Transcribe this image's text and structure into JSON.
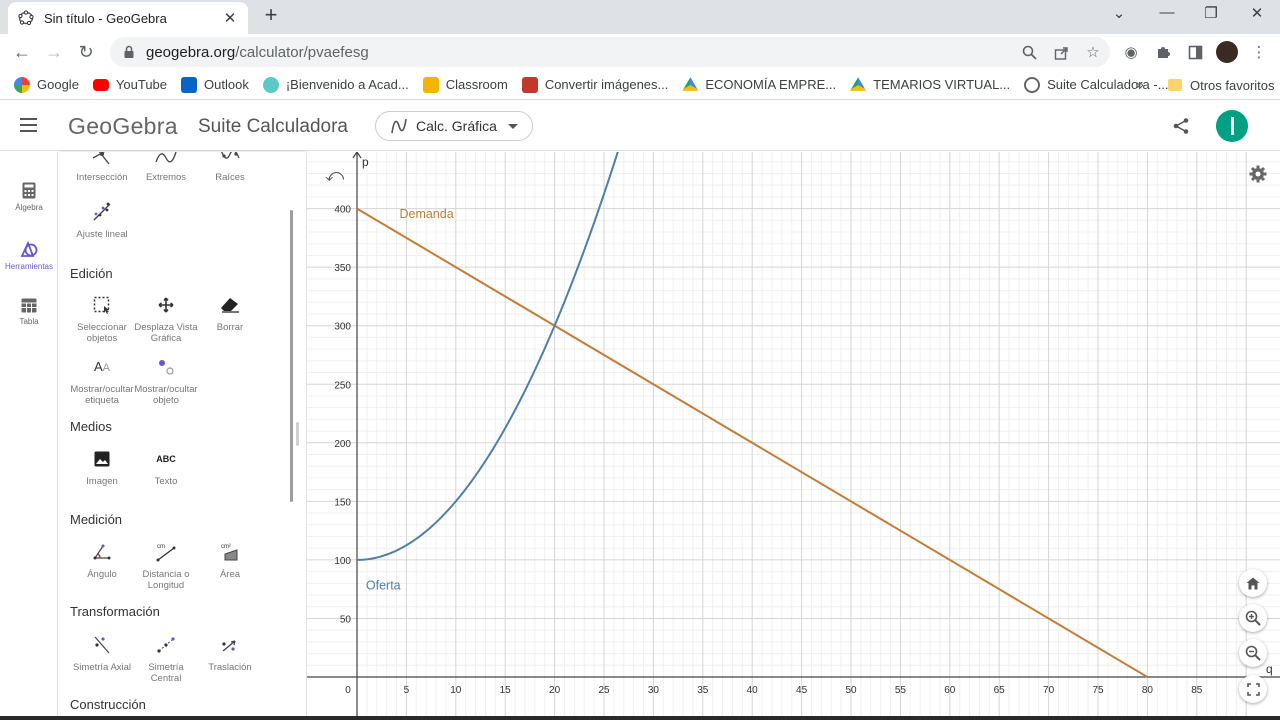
{
  "browser": {
    "tab_title": "Sin título - GeoGebra",
    "url_host": "geogebra.org",
    "url_path": "/calculator/pvaefesg",
    "bookmarks": [
      {
        "label": "Google",
        "color": "#4285f4"
      },
      {
        "label": "YouTube",
        "color": "#ff0000"
      },
      {
        "label": "Outlook",
        "color": "#0a64c8"
      },
      {
        "label": "¡Bienvenido a Acad...",
        "color": "#5cc8c8"
      },
      {
        "label": "Classroom",
        "color": "#f4b400"
      },
      {
        "label": "Convertir imágenes...",
        "color": "#c0392b"
      },
      {
        "label": "ECONOMÍA EMPRE...",
        "color": "#1fa463"
      },
      {
        "label": "TEMARIOS VIRTUAL...",
        "color": "#1fa463"
      },
      {
        "label": "Suite Calculadora -...",
        "color": "#666666"
      }
    ],
    "other_bookmarks": "Otros favoritos"
  },
  "app": {
    "logo": "GeoGebra",
    "suite_title": "Suite Calculadora",
    "app_selector": "Calc. Gráfica",
    "rail": [
      {
        "label": "Álgebra"
      },
      {
        "label": "Herramientas"
      },
      {
        "label": "Tabla"
      }
    ]
  },
  "tools": {
    "top_row": [
      "Intersección",
      "Extremos",
      "Raíces"
    ],
    "ajuste": "Ajuste lineal",
    "sections": {
      "edicion": "Edición",
      "medios": "Medios",
      "medicion": "Medición",
      "transformacion": "Transformación",
      "construccion": "Construcción"
    },
    "edicion": [
      {
        "line1": "Seleccionar",
        "line2": "objetos"
      },
      {
        "line1": "Desplaza Vista",
        "line2": "Gráfica"
      },
      {
        "line1": "Borrar",
        "line2": ""
      },
      {
        "line1": "Mostrar/ocultar",
        "line2": "etiqueta"
      },
      {
        "line1": "Mostrar/ocultar",
        "line2": "objeto"
      }
    ],
    "medios": [
      {
        "line1": "Imagen"
      },
      {
        "line1": "Texto",
        "glyph": "ABC"
      }
    ],
    "medicion": [
      {
        "line1": "Ángulo",
        "line2": ""
      },
      {
        "line1": "Distancia o",
        "line2": "Longitud"
      },
      {
        "line1": "Área",
        "line2": ""
      }
    ],
    "transformacion": [
      {
        "line1": "Simetría Axial",
        "line2": ""
      },
      {
        "line1": "Simetría",
        "line2": "Central"
      },
      {
        "line1": "Traslación",
        "line2": ""
      }
    ]
  },
  "chart_data": {
    "type": "line",
    "xlabel": "q",
    "ylabel": "p",
    "xlim": [
      0,
      90
    ],
    "ylim": [
      0,
      450
    ],
    "x_ticks": [
      0,
      5,
      10,
      15,
      20,
      25,
      30,
      35,
      40,
      45,
      50,
      55,
      60,
      65,
      70,
      75,
      80,
      85
    ],
    "y_ticks": [
      50,
      100,
      150,
      200,
      250,
      300,
      350,
      400
    ],
    "grid": true,
    "series": [
      {
        "name": "Demanda",
        "color": "#c57b3a",
        "formula": "p = 400 - 5q",
        "x": [
          0,
          80
        ],
        "y": [
          400,
          0
        ]
      },
      {
        "name": "Oferta",
        "color": "#4f7fa8",
        "formula": "p = 100 + 0.5q^2",
        "x": [
          0,
          5,
          10,
          15,
          20,
          25,
          27
        ],
        "y": [
          100,
          112.5,
          150,
          212.5,
          300,
          412.5,
          464.5
        ]
      }
    ]
  }
}
